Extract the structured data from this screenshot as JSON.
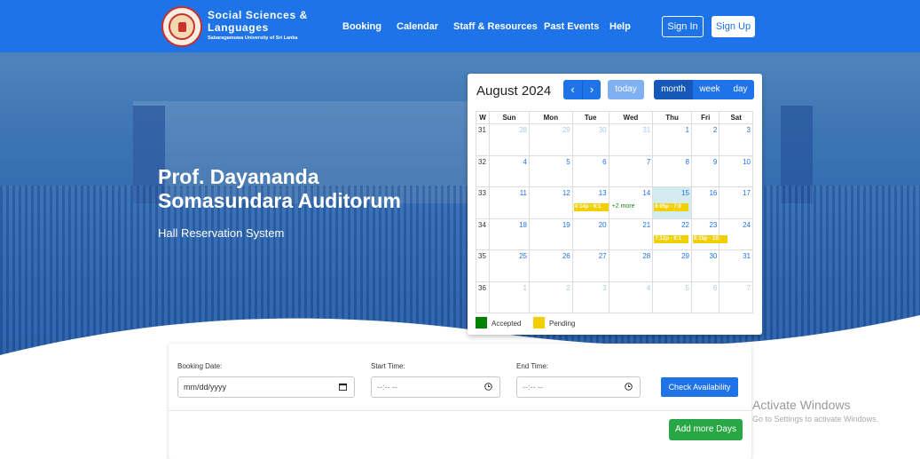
{
  "navbar": {
    "brand_line1": "Social Sciences &",
    "brand_line2": "Languages",
    "brand_line3": "Sabaragamuwa University of Sri Lanka",
    "links": [
      "Booking",
      "Calendar",
      "Staff & Resources",
      "Past Events",
      "Help"
    ],
    "sign_in": "Sign In",
    "sign_up": "Sign Up"
  },
  "hero": {
    "title_line1": "Prof. Dayananda",
    "title_line2": "Somasundara Auditorum",
    "subtitle": "Hall Reservation System"
  },
  "calendar": {
    "title": "August 2024",
    "prev_icon": "chevron-left-icon",
    "next_icon": "chevron-right-icon",
    "today_label": "today",
    "views": [
      "month",
      "week",
      "day"
    ],
    "active_view": "month",
    "headers": [
      "W",
      "Sun",
      "Mon",
      "Tue",
      "Wed",
      "Thu",
      "Fri",
      "Sat"
    ],
    "weeks": [
      {
        "wk": "31",
        "days": [
          {
            "d": "28",
            "other": true
          },
          {
            "d": "29",
            "other": true
          },
          {
            "d": "30",
            "other": true
          },
          {
            "d": "31",
            "other": true
          },
          {
            "d": "1"
          },
          {
            "d": "2"
          },
          {
            "d": "3"
          }
        ]
      },
      {
        "wk": "32",
        "days": [
          {
            "d": "4"
          },
          {
            "d": "5"
          },
          {
            "d": "6"
          },
          {
            "d": "7"
          },
          {
            "d": "8"
          },
          {
            "d": "9"
          },
          {
            "d": "10"
          }
        ]
      },
      {
        "wk": "33",
        "days": [
          {
            "d": "11"
          },
          {
            "d": "12"
          },
          {
            "d": "13",
            "event": "4:14p - 6:1"
          },
          {
            "d": "14",
            "more": "+2 more"
          },
          {
            "d": "15",
            "today": true,
            "event": "6:05p - 7:0"
          },
          {
            "d": "16"
          },
          {
            "d": "17"
          }
        ]
      },
      {
        "wk": "34",
        "days": [
          {
            "d": "18"
          },
          {
            "d": "19"
          },
          {
            "d": "20"
          },
          {
            "d": "21"
          },
          {
            "d": "22",
            "event": "7:12p - 9:1"
          },
          {
            "d": "23",
            "event": "8:15p - 10:"
          },
          {
            "d": "24"
          }
        ]
      },
      {
        "wk": "35",
        "days": [
          {
            "d": "25"
          },
          {
            "d": "26"
          },
          {
            "d": "27"
          },
          {
            "d": "28"
          },
          {
            "d": "29"
          },
          {
            "d": "30"
          },
          {
            "d": "31"
          }
        ]
      },
      {
        "wk": "36",
        "days": [
          {
            "d": "1",
            "other": true
          },
          {
            "d": "2",
            "other": true
          },
          {
            "d": "3",
            "other": true
          },
          {
            "d": "4",
            "other": true
          },
          {
            "d": "5",
            "other": true
          },
          {
            "d": "6",
            "other": true
          },
          {
            "d": "7",
            "other": true
          }
        ]
      }
    ],
    "legend": [
      {
        "label": "Accepted",
        "color": "#008000"
      },
      {
        "label": "Pending",
        "color": "#f2cf00"
      }
    ]
  },
  "booking_form": {
    "date_label": "Booking Date:",
    "date_placeholder": "mm/dd/yyyy",
    "start_label": "Start Time:",
    "start_placeholder": "--:-- --",
    "end_label": "End Time:",
    "end_placeholder": "--:-- --",
    "check_button": "Check Availability",
    "add_button": "Add more Days"
  },
  "watermark": {
    "line1": "Activate Windows",
    "line2": "Go to Settings to activate Windows."
  },
  "colors": {
    "primary": "#1e73e8",
    "accepted": "#008000",
    "pending": "#f2cf00",
    "success_button": "#28a745"
  }
}
